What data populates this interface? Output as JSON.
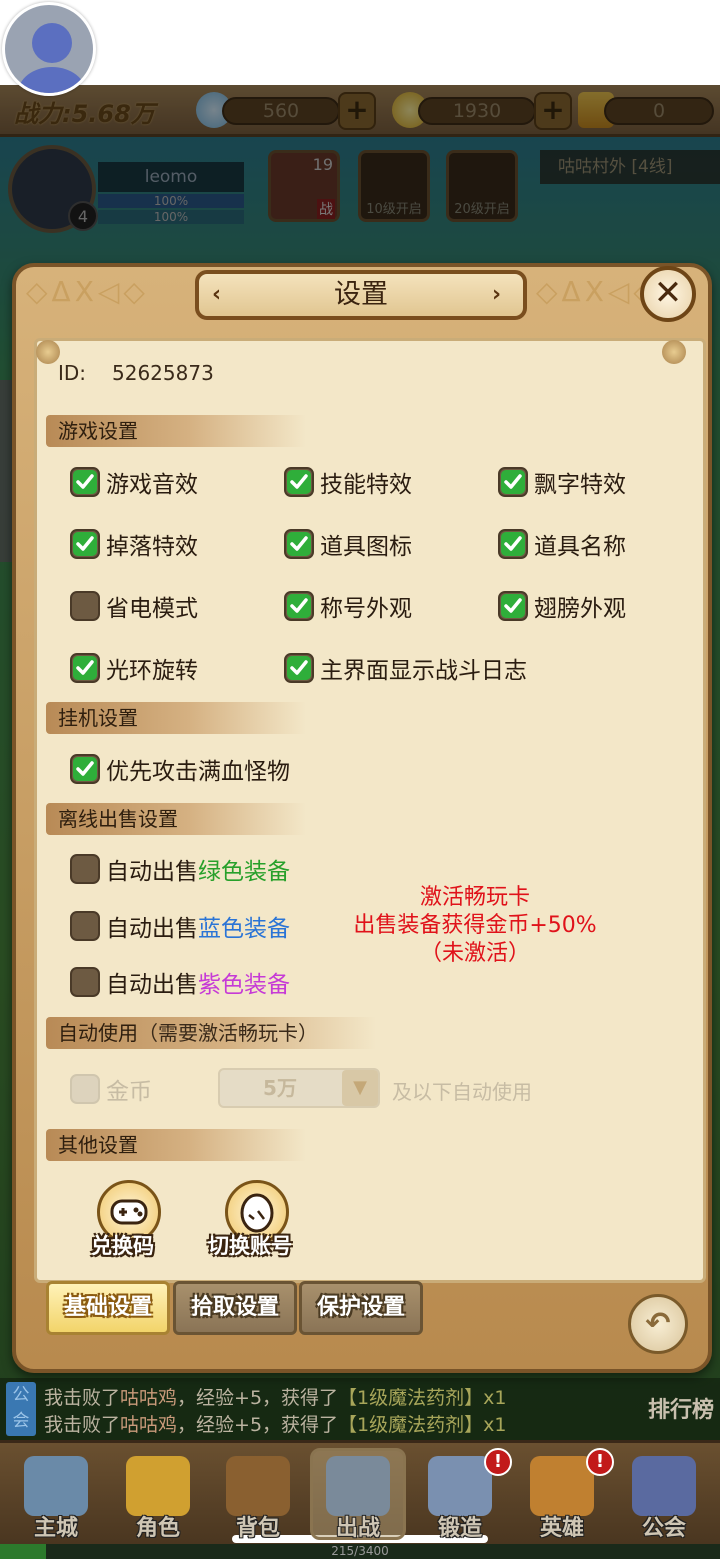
{
  "hud": {
    "power_label": "战力:5.68万",
    "diamonds": "560",
    "gold": "1930",
    "tickets": "0",
    "player_name": "leomo",
    "player_level": "4",
    "hp_text": "100%",
    "mp_text": "100%",
    "hero_level": "19",
    "hero_tag": "战",
    "slot_locks": [
      "10级开启",
      "20级开启"
    ],
    "map_name": "咕咕村外 [4线]"
  },
  "dialog": {
    "title": "设置",
    "close_symbol": "✕",
    "id_label": "ID:",
    "id_value": "52625873",
    "sections": {
      "game": "游戏设置",
      "idle": "挂机设置",
      "offline_sell": "离线出售设置",
      "auto_use": "自动使用",
      "auto_use_note": "（需要激活畅玩卡）",
      "other": "其他设置"
    },
    "game_options": [
      {
        "label": "游戏音效",
        "checked": true
      },
      {
        "label": "技能特效",
        "checked": true
      },
      {
        "label": "飘字特效",
        "checked": true
      },
      {
        "label": "掉落特效",
        "checked": true
      },
      {
        "label": "道具图标",
        "checked": true
      },
      {
        "label": "道具名称",
        "checked": true
      },
      {
        "label": "省电模式",
        "checked": false
      },
      {
        "label": "称号外观",
        "checked": true
      },
      {
        "label": "翅膀外观",
        "checked": true
      },
      {
        "label": "光环旋转",
        "checked": true
      },
      {
        "label": "主界面显示战斗日志",
        "checked": true
      }
    ],
    "idle_options": [
      {
        "label": "优先攻击满血怪物",
        "checked": true
      }
    ],
    "sell_prefix": "自动出售",
    "sell_options": [
      {
        "color_label": "绿色装备",
        "color": "green",
        "checked": false
      },
      {
        "color_label": "蓝色装备",
        "color": "blue",
        "checked": false
      },
      {
        "color_label": "紫色装备",
        "color": "purple",
        "checked": false
      }
    ],
    "promo_lines": [
      "激活畅玩卡",
      "出售装备获得金币+50%",
      "（未激活）"
    ],
    "auto_use": {
      "label": "金币",
      "checked": false,
      "selected_value": "5万",
      "suffix": "及以下自动使用"
    },
    "other_buttons": [
      "兑换码",
      "切换账号"
    ],
    "tabs": [
      {
        "label": "基础设置",
        "active": true
      },
      {
        "label": "拾取设置",
        "active": false
      },
      {
        "label": "保护设置",
        "active": false
      }
    ],
    "back_symbol": "↶"
  },
  "side_tab_symbol": "❯",
  "chat": {
    "tag": "公会",
    "lines": [
      {
        "pre": "我击败了",
        "mob": "咕咕鸡",
        "mid": "，经验+5，获得了",
        "item": "【1级魔法药剂】x1"
      },
      {
        "pre": "我击败了",
        "mob": "咕咕鸡",
        "mid": "，经验+5，获得了",
        "item": "【1级魔法药剂】x1"
      }
    ],
    "rank_label": "排行榜"
  },
  "nav": [
    {
      "label": "主城",
      "badge": ""
    },
    {
      "label": "角色",
      "badge": ""
    },
    {
      "label": "背包",
      "badge": ""
    },
    {
      "label": "出战",
      "badge": ""
    },
    {
      "label": "锻造",
      "badge": "!"
    },
    {
      "label": "英雄",
      "badge": "!"
    },
    {
      "label": "公会",
      "badge": ""
    }
  ],
  "exp": {
    "text": "215/3400",
    "current": 215,
    "max": 3400
  },
  "colors": {
    "check_green": "#27a02a",
    "sell_green": "#27a02a",
    "sell_blue": "#2a74d6",
    "sell_purple": "#c63ad6",
    "promo_red": "#e0121a"
  }
}
